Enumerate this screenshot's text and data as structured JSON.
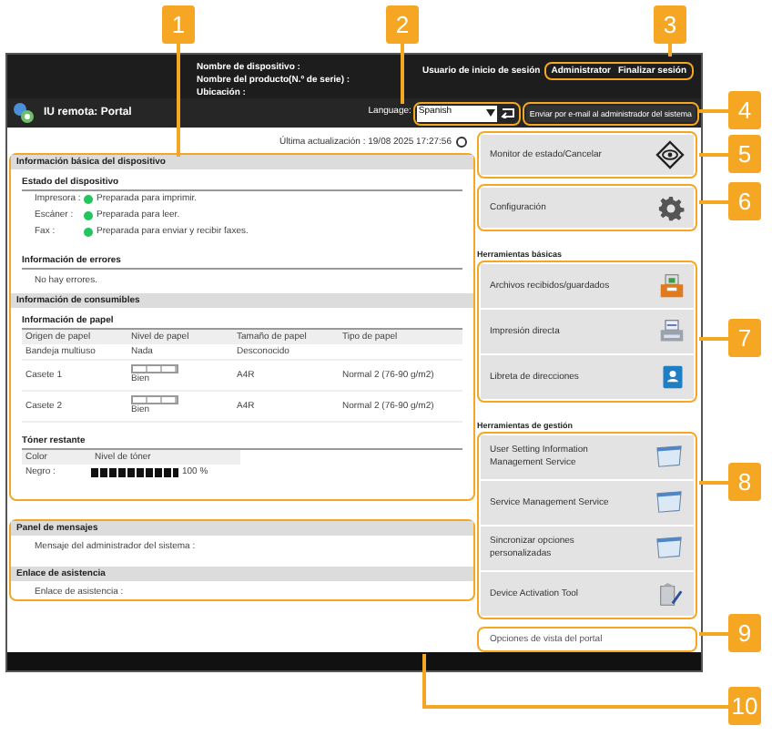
{
  "header": {
    "device_lines": [
      "Nombre de dispositivo :",
      "Nombre del producto(N.º de serie) :",
      "Ubicación :"
    ],
    "login_label": "Usuario de inicio de sesión",
    "user": "Administrator",
    "logout": "Finalizar sesión"
  },
  "nav": {
    "title": "IU remota: Portal",
    "language_label": "Language:",
    "language": "Spanish",
    "email_button": "Enviar por e-mail al administrador del sistema"
  },
  "last_update": "Última actualización : 19/08 2025 17:27:56",
  "device_info": {
    "title": "Información básica del dispositivo",
    "status_title": "Estado del dispositivo",
    "status": [
      {
        "label": "Impresora :",
        "text": "Preparada para imprimir.",
        "color": "#22c55e"
      },
      {
        "label": "Escáner :",
        "text": "Preparada para leer.",
        "color": "#22c55e"
      },
      {
        "label": "Fax :",
        "text": "Preparada para enviar y recibir faxes.",
        "color": "#22c55e"
      }
    ],
    "errors_title": "Información de errores",
    "errors": "No hay errores."
  },
  "consumables": {
    "title": "Información de consumibles",
    "paper_title": "Información de papel",
    "columns": [
      "Origen de papel",
      "Nivel de papel",
      "Tamaño de papel",
      "Tipo de papel"
    ],
    "rows": [
      {
        "kind": "text",
        "source": "Bandeja multiuso",
        "level_text": "Nada",
        "size": "Desconocido"
      },
      {
        "kind": "meter",
        "source": "Casete 1",
        "level_text": "Bien",
        "size": "A4R",
        "type": "Normal 2 (76-90 g/m2)"
      },
      {
        "kind": "meter",
        "source": "Casete 2",
        "level_text": "Bien",
        "size": "A4R",
        "type": "Normal 2 (76-90 g/m2)"
      }
    ],
    "toner_title": "Tóner restante",
    "toner_columns": [
      "Color",
      "Nivel de tóner"
    ],
    "toner": [
      {
        "label": "Negro :",
        "level": 1.0,
        "reading": "100 %"
      }
    ]
  },
  "messages": {
    "title": "Panel de mensajes",
    "text": "Mensaje del administrador del sistema :"
  },
  "support": {
    "title": "Enlace de asistencia",
    "text": "Enlace de asistencia :"
  },
  "main_buttons": [
    {
      "kind": "monitor",
      "label": "Monitor de estado/Cancelar"
    },
    {
      "kind": "settings",
      "label": "Configuración"
    }
  ],
  "basic_tools": {
    "title": "Herramientas básicas",
    "items": [
      {
        "kind": "inbox",
        "label": "Archivos recibidos/guardados"
      },
      {
        "kind": "print",
        "label": "Impresión directa"
      },
      {
        "kind": "addressbook",
        "label": "Libreta de direcciones"
      }
    ]
  },
  "management_tools": {
    "title": "Herramientas de gestión",
    "items": [
      {
        "kind": "app",
        "label": "User Setting Information Management Service"
      },
      {
        "kind": "app",
        "label": "Service Management Service"
      },
      {
        "kind": "app",
        "label": "Sincronizar opciones personalizadas"
      },
      {
        "kind": "tool",
        "label": "Device Activation Tool"
      }
    ]
  },
  "portal_link": "Opciones de vista del portal",
  "callouts": [
    "1",
    "2",
    "3",
    "4",
    "5",
    "6",
    "7",
    "8",
    "9",
    "10"
  ]
}
